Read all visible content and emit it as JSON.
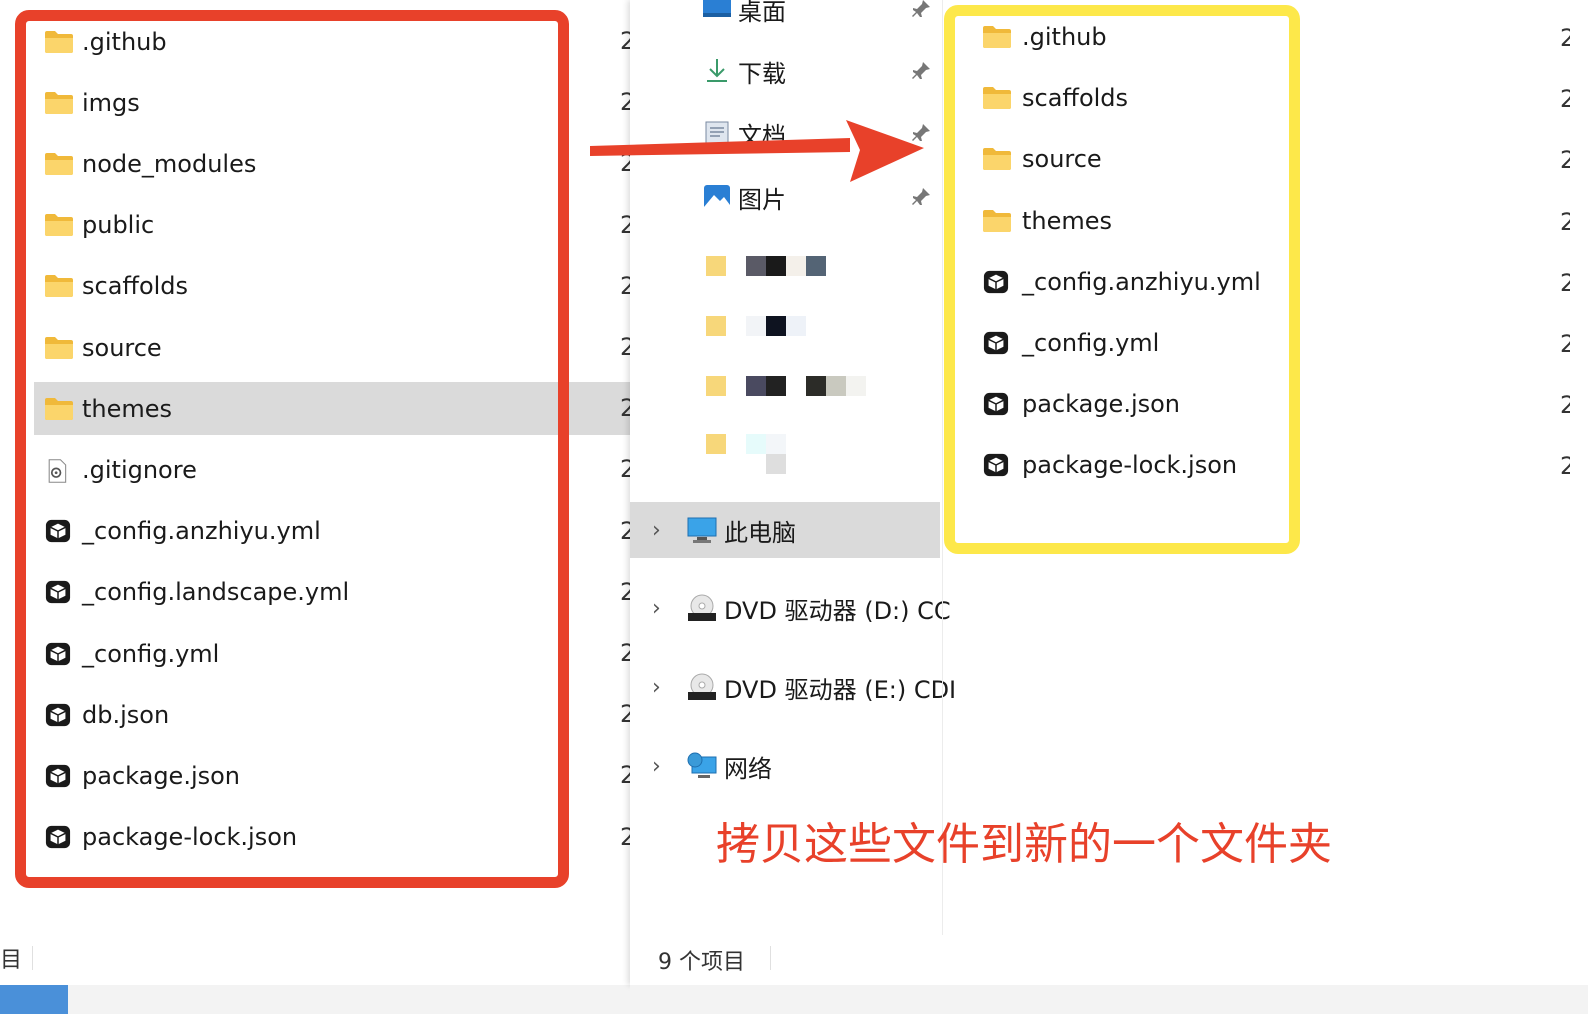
{
  "left_window": {
    "files": [
      {
        "name": ".github",
        "icon": "folder-icon",
        "selected": false
      },
      {
        "name": "imgs",
        "icon": "folder-icon",
        "selected": false
      },
      {
        "name": "node_modules",
        "icon": "folder-icon",
        "selected": false
      },
      {
        "name": "public",
        "icon": "folder-icon",
        "selected": false
      },
      {
        "name": "scaffolds",
        "icon": "folder-icon",
        "selected": false
      },
      {
        "name": "source",
        "icon": "folder-icon",
        "selected": false
      },
      {
        "name": "themes",
        "icon": "folder-icon",
        "selected": true
      },
      {
        "name": ".gitignore",
        "icon": "settings-file-icon",
        "selected": false
      },
      {
        "name": "_config.anzhiyu.yml",
        "icon": "box-file-icon",
        "selected": false
      },
      {
        "name": "_config.landscape.yml",
        "icon": "box-file-icon",
        "selected": false
      },
      {
        "name": "_config.yml",
        "icon": "box-file-icon",
        "selected": false
      },
      {
        "name": "db.json",
        "icon": "box-file-icon",
        "selected": false
      },
      {
        "name": "package.json",
        "icon": "box-file-icon",
        "selected": false
      },
      {
        "name": "package-lock.json",
        "icon": "box-file-icon",
        "selected": false
      }
    ],
    "date_stub": "2",
    "status_text": "目"
  },
  "right_window": {
    "quick_access": [
      {
        "label": "桌面",
        "icon": "desktop-icon"
      },
      {
        "label": "下载",
        "icon": "download-icon"
      },
      {
        "label": "文档",
        "icon": "document-icon"
      },
      {
        "label": "图片",
        "icon": "picture-icon"
      }
    ],
    "tree": [
      {
        "label": "此电脑",
        "icon": "computer-icon",
        "selected": true
      },
      {
        "label": "DVD 驱动器 (D:) CC",
        "icon": "dvd-icon",
        "selected": false
      },
      {
        "label": "DVD 驱动器 (E:) CDI",
        "icon": "dvd-icon",
        "selected": false
      },
      {
        "label": "网络",
        "icon": "network-icon",
        "selected": false
      }
    ],
    "tree_chevron": "›",
    "files": [
      {
        "name": ".github",
        "icon": "folder-icon"
      },
      {
        "name": "scaffolds",
        "icon": "folder-icon"
      },
      {
        "name": "source",
        "icon": "folder-icon"
      },
      {
        "name": "themes",
        "icon": "folder-icon"
      },
      {
        "name": "_config.anzhiyu.yml",
        "icon": "box-file-icon"
      },
      {
        "name": "_config.yml",
        "icon": "box-file-icon"
      },
      {
        "name": "package.json",
        "icon": "box-file-icon"
      },
      {
        "name": "package-lock.json",
        "icon": "box-file-icon"
      }
    ],
    "date_stub": "2",
    "status_text": "9 个项目"
  },
  "annotation": {
    "caption": "拷贝这些文件到新的一个文件夹",
    "red_color": "#e8412a",
    "yellow_color": "#fde84a"
  }
}
